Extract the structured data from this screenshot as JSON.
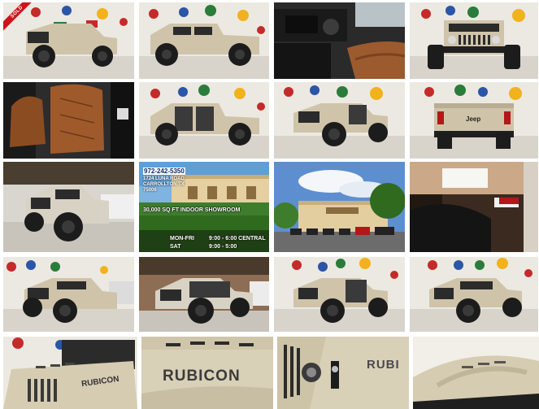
{
  "gallery": {
    "badges": {
      "sold": "SOLD"
    },
    "tiles": [
      {
        "label": "jeep-front-left-sold"
      },
      {
        "label": "jeep-side-left"
      },
      {
        "label": "interior-dashboard"
      },
      {
        "label": "jeep-front"
      },
      {
        "label": "interior-seats"
      },
      {
        "label": "jeep-doors-off-side"
      },
      {
        "label": "jeep-doors-off-front-left"
      },
      {
        "label": "jeep-rear"
      },
      {
        "label": "jeep-showroom-front-left"
      },
      {
        "label": "dealership-info"
      },
      {
        "label": "dealership-building"
      },
      {
        "label": "showroom-interior"
      },
      {
        "label": "jeep-front-left-2"
      },
      {
        "label": "jeep-doors-off-front-left-2"
      },
      {
        "label": "jeep-doors-off-front-left-3"
      },
      {
        "label": "jeep-front-left-3"
      },
      {
        "label": "hood-closeup"
      },
      {
        "label": "rubicon-decal"
      },
      {
        "label": "hood-latch-closeup"
      },
      {
        "label": "hood-top"
      }
    ],
    "dealer": {
      "phone": "972-242-5350",
      "street": "1724 LUNA ROAD",
      "city": "CARROLLTON TX",
      "zip": "75006",
      "showroom": "30,000 SQ FT INDOOR SHOWROOM",
      "hours_weekday_label": "MON-FRI",
      "hours_weekday": "9:00 - 6:00 CENTRAL",
      "hours_sat_label": "SAT",
      "hours_sat": "9:00 - 5:00"
    },
    "decals": {
      "rubicon_large": "RUBICON",
      "rubicon_small": "RUBICON",
      "rubicon_latch": "RUBI",
      "jeep_badge": "Jeep"
    }
  }
}
